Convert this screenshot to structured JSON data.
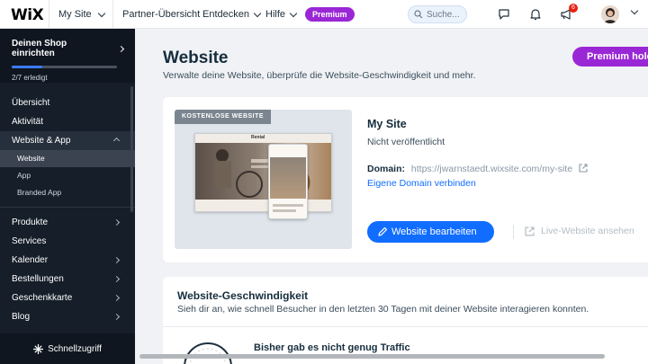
{
  "topbar": {
    "logo": "WiX",
    "site_selector": "My Site",
    "nav": [
      "Partner-Übersicht",
      "Entdecken",
      "Hilfe"
    ],
    "premium": "Premium",
    "search_placeholder": "Suche...",
    "notification_count": "6"
  },
  "sidebar": {
    "setup_title": "Deinen Shop einrichten",
    "setup_progress": "2/7 erledigt",
    "setup_progress_fraction": 0.29,
    "items": [
      {
        "label": "Übersicht"
      },
      {
        "label": "Aktivität"
      },
      {
        "label": "Website & App"
      },
      {
        "label": "Website"
      },
      {
        "label": "App"
      },
      {
        "label": "Branded App"
      },
      {
        "label": "Produkte"
      },
      {
        "label": "Services"
      },
      {
        "label": "Kalender"
      },
      {
        "label": "Bestellungen"
      },
      {
        "label": "Geschenkkarte"
      },
      {
        "label": "Blog"
      }
    ],
    "quick_access": "Schnellzugriff"
  },
  "main": {
    "title": "Website",
    "subtitle": "Verwalte deine Website, überprüfe die Website-Geschwindigkeit und mehr.",
    "premium_button": "Premium holen",
    "site_card": {
      "preview_tag": "KOSTENLOSE WEBSITE",
      "preview_brand": "Rental",
      "site_name": "My Site",
      "status": "Nicht veröffentlicht",
      "domain_label": "Domain:",
      "domain_url": "https://jwarnstaedt.wixsite.com/my-site",
      "connect_domain": "Eigene Domain verbinden",
      "edit_button": "Website bearbeiten",
      "live_link": "Live-Website ansehen"
    },
    "speed_card": {
      "title": "Website-Geschwindigkeit",
      "subtitle": "Sieh dir an, wie schnell Besucher in den letzten 30 Tagen mit deiner Website interagieren konnten.",
      "no_traffic": "Bisher gab es nicht genug Traffic"
    }
  },
  "colors": {
    "accent": "#116dff",
    "premium": "#9a27d5",
    "sidebar_bg": "#151e29"
  }
}
